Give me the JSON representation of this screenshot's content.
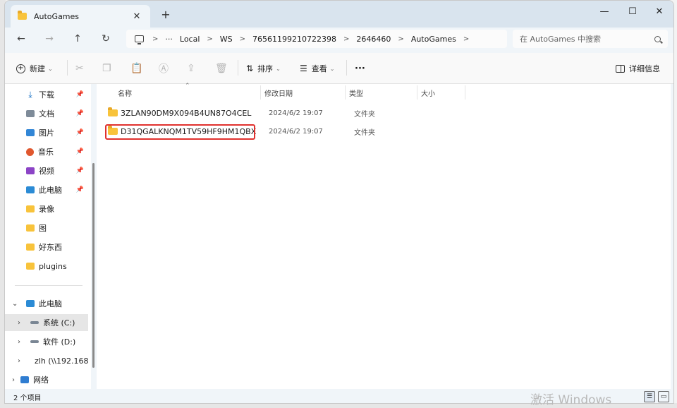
{
  "tab": {
    "title": "AutoGames",
    "close": "✕",
    "new": "+"
  },
  "window_controls": {
    "minimize": "—",
    "maximize": "☐",
    "close": "✕"
  },
  "nav": {
    "back": "←",
    "forward": "→",
    "up": "↑",
    "refresh": "↻"
  },
  "address": {
    "more": "···",
    "crumbs": [
      "Local",
      "WS",
      "76561199210722398",
      "2646460",
      "AutoGames"
    ],
    "sep": ">"
  },
  "search": {
    "placeholder": "在 AutoGames 中搜索"
  },
  "toolbar": {
    "new_label": "新建",
    "new_caret": "⌄",
    "sort_label": "排序",
    "view_label": "查看",
    "more": "···",
    "details_label": "详细信息"
  },
  "sidebar": {
    "quick": [
      {
        "label": "下载",
        "icon": "download-icon",
        "pinned": true
      },
      {
        "label": "文档",
        "icon": "document-icon",
        "pinned": true
      },
      {
        "label": "图片",
        "icon": "pictures-icon",
        "pinned": true
      },
      {
        "label": "音乐",
        "icon": "music-icon",
        "pinned": true
      },
      {
        "label": "视频",
        "icon": "video-icon",
        "pinned": true
      },
      {
        "label": "此电脑",
        "icon": "computer-icon",
        "pinned": true
      },
      {
        "label": "录像",
        "icon": "folder-icon",
        "pinned": false
      },
      {
        "label": "图",
        "icon": "folder-icon",
        "pinned": false
      },
      {
        "label": "好东西",
        "icon": "folder-icon",
        "pinned": false
      },
      {
        "label": "plugins",
        "icon": "folder-icon",
        "pinned": false
      }
    ],
    "this_pc": "此电脑",
    "drives": [
      {
        "label": "系统 (C:)",
        "selected": true
      },
      {
        "label": "软件 (D:)",
        "selected": false
      },
      {
        "label": "zlh (\\\\192.168",
        "selected": false
      }
    ],
    "network": "网络"
  },
  "columns": {
    "name": "名称",
    "modified": "修改日期",
    "type": "类型",
    "size": "大小"
  },
  "files": [
    {
      "name": "3ZLAN90DM9X094B4UN87O4CEL",
      "modified": "2024/6/2 19:07",
      "type": "文件夹",
      "size": ""
    },
    {
      "name": "D31QGALKNQM1TV59HF9HM1QBX",
      "modified": "2024/6/2 19:07",
      "type": "文件夹",
      "size": ""
    }
  ],
  "status": {
    "count": "2 个项目"
  },
  "watermark": "激活 Windows",
  "colors": {
    "accent": "#005fb8",
    "highlight_box": "#e0312e",
    "folder": "#f8c33b"
  }
}
